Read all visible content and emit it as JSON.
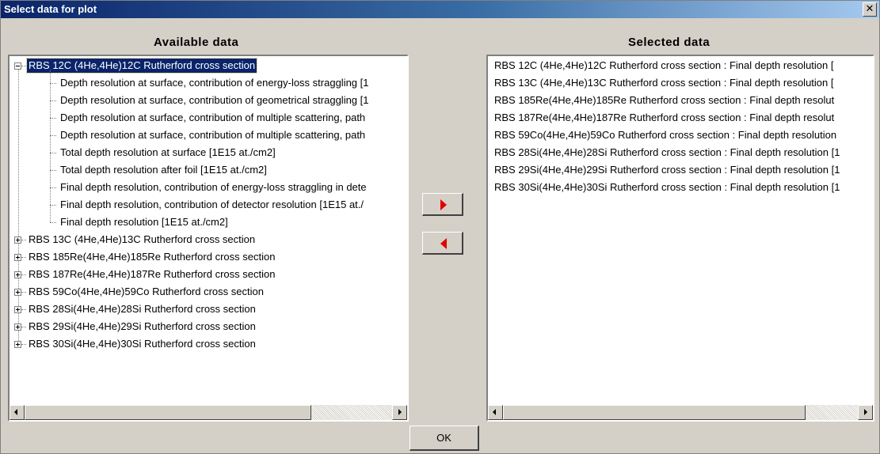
{
  "window": {
    "title": "Select data for plot",
    "close_glyph": "✕"
  },
  "available": {
    "header": "Available data",
    "tree": [
      {
        "label": "RBS 12C (4He,4He)12C  Rutherford cross section",
        "expanded": true,
        "selected": true,
        "children": [
          "Depth resolution at surface, contribution of energy-loss straggling [1",
          "Depth resolution at surface, contribution of geometrical straggling [1",
          "Depth resolution at surface, contribution of multiple scattering, path",
          "Depth resolution at surface, contribution of multiple scattering, path",
          "Total depth resolution at surface [1E15 at./cm2]",
          "Total depth resolution after foil [1E15 at./cm2]",
          "Final depth resolution, contribution of energy-loss straggling in dete",
          "Final depth resolution, contribution of detector resolution [1E15 at./",
          "Final depth resolution [1E15 at./cm2]"
        ]
      },
      {
        "label": "RBS 13C (4He,4He)13C  Rutherford cross section",
        "expanded": false
      },
      {
        "label": "RBS 185Re(4He,4He)185Re Rutherford cross section",
        "expanded": false
      },
      {
        "label": "RBS 187Re(4He,4He)187Re Rutherford cross section",
        "expanded": false
      },
      {
        "label": "RBS 59Co(4He,4He)59Co Rutherford cross section",
        "expanded": false
      },
      {
        "label": "RBS 28Si(4He,4He)28Si Rutherford cross section",
        "expanded": false
      },
      {
        "label": "RBS 29Si(4He,4He)29Si Rutherford cross section",
        "expanded": false
      },
      {
        "label": "RBS 30Si(4He,4He)30Si Rutherford cross section",
        "expanded": false
      }
    ]
  },
  "selected": {
    "header": "Selected data",
    "items": [
      "RBS 12C (4He,4He)12C  Rutherford cross section : Final depth resolution [",
      "RBS 13C (4He,4He)13C  Rutherford cross section : Final depth resolution [",
      "RBS 185Re(4He,4He)185Re Rutherford cross section : Final depth resolut",
      "RBS 187Re(4He,4He)187Re Rutherford cross section : Final depth resolut",
      "RBS 59Co(4He,4He)59Co Rutherford cross section : Final depth resolution",
      "RBS 28Si(4He,4He)28Si Rutherford cross section : Final depth resolution [1",
      "RBS 29Si(4He,4He)29Si Rutherford cross section : Final depth resolution [1",
      "RBS 30Si(4He,4He)30Si Rutherford cross section : Final depth resolution [1"
    ]
  },
  "buttons": {
    "add_icon": "arrow-right-icon",
    "remove_icon": "arrow-left-icon",
    "ok": "OK",
    "accent_color": "#e00000"
  }
}
